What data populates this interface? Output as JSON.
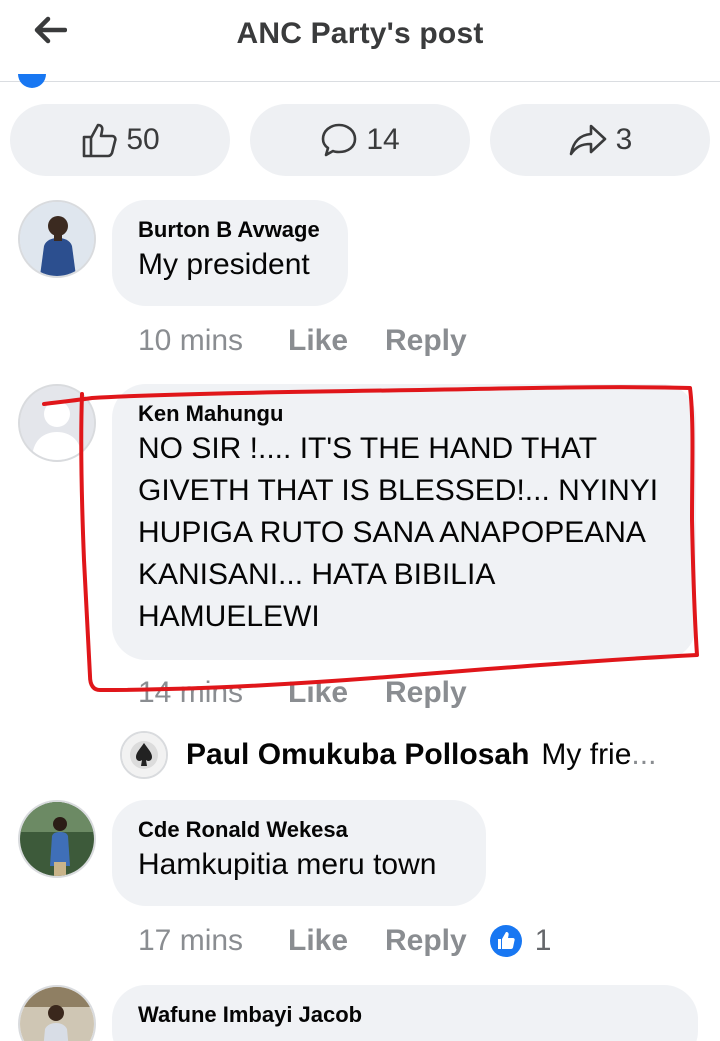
{
  "header": {
    "title": "ANC Party's post",
    "back_icon": "back-arrow-icon"
  },
  "post_actions": {
    "likes": "50",
    "comments": "14",
    "shares": "3"
  },
  "comments": [
    {
      "author": "Burton B Avwage",
      "text": "My president",
      "time": "10 mins",
      "like": "Like",
      "reply": "Reply"
    },
    {
      "author": "Ken Mahungu",
      "text_lines": [
        "NO SIR !.... IT'S THE HAND THAT",
        "GIVETH THAT IS BLESSED!... NYINYI",
        "HUPIGA RUTO SANA ANAPOPEANA",
        "KANISANI... HATA BIBILIA",
        "HAMUELEWI"
      ],
      "time": "14 mins",
      "like": "Like",
      "reply": "Reply"
    },
    {
      "author": "Cde Ronald Wekesa",
      "text": "Hamkupitia meru town",
      "time": "17 mins",
      "like": "Like",
      "reply": "Reply",
      "reaction_count": "1"
    },
    {
      "author": "Wafune Imbayi Jacob"
    }
  ],
  "reply_preview": {
    "author": "Paul Omukuba Pollosah",
    "text": "My frie",
    "ellipsis": "..."
  },
  "colors": {
    "accent": "#1877f2",
    "annotation": "#e0161a",
    "bubble": "#f0f2f5",
    "meta": "#8a8d91"
  }
}
